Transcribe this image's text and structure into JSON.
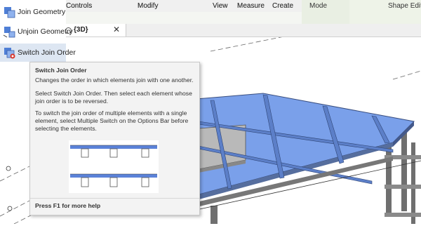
{
  "ribbon": {
    "panels": [
      "Controls",
      "Modify",
      "View",
      "Measure",
      "Create",
      "Mode",
      "Shape Editin"
    ]
  },
  "dropdown": {
    "items": [
      {
        "label": "Join Geometry",
        "icon": "join-geometry-icon"
      },
      {
        "label": "Unjoin Geometry",
        "icon": "unjoin-geometry-icon"
      },
      {
        "label": "Switch Join Order",
        "icon": "switch-join-order-icon"
      }
    ]
  },
  "view_tab": {
    "label": "{3D}",
    "close": "✕"
  },
  "tooltip": {
    "title": "Switch Join Order",
    "description": "Changes the order in which elements join with one another.",
    "para1": "Select Switch Join Order. Then select each element whose join order is to be reversed.",
    "para2": "To switch the join order of multiple elements with a single element, select Multiple Switch on the Options Bar before selecting the elements.",
    "footer": "Press F1 for more help"
  },
  "colors": {
    "accent_blue": "#5b82d9",
    "floor_blue": "#8ea9e8",
    "selected_item": "#dde6f2"
  }
}
